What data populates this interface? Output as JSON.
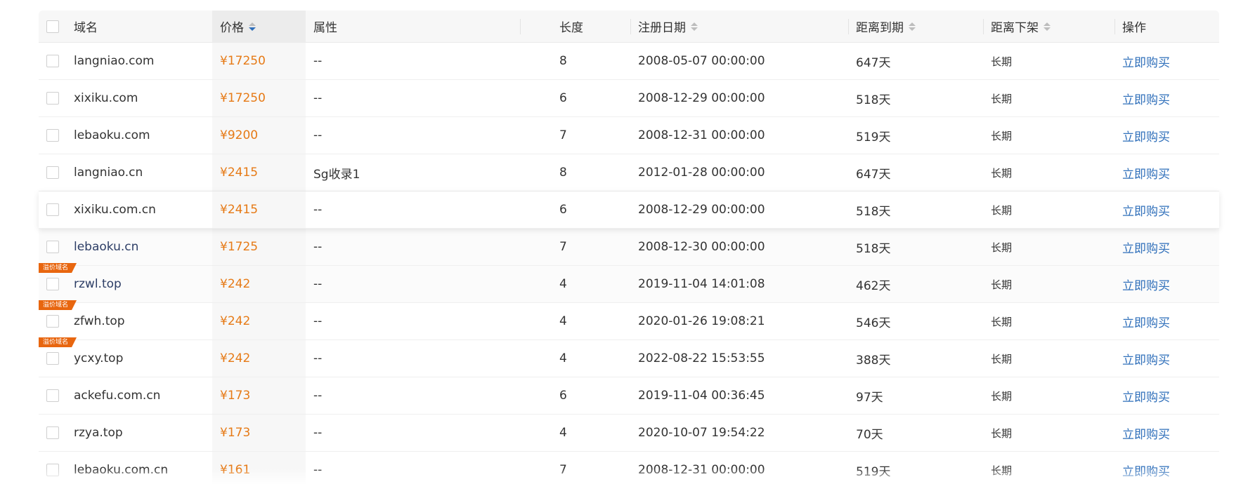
{
  "header": {
    "domain": "域名",
    "price": "价格",
    "attr": "属性",
    "length": "长度",
    "reg_date": "注册日期",
    "expire": "距离到期",
    "offshelf": "距离下架",
    "op": "操作"
  },
  "rows": [
    {
      "domain": "langniao.com",
      "price": "¥17250",
      "attr": "--",
      "length": "8",
      "reg_date": "2008-05-07 00:00:00",
      "expire": "647天",
      "offshelf": "长期",
      "op": "立即购买"
    },
    {
      "domain": "xixiku.com",
      "price": "¥17250",
      "attr": "--",
      "length": "6",
      "reg_date": "2008-12-29 00:00:00",
      "expire": "518天",
      "offshelf": "长期",
      "op": "立即购买"
    },
    {
      "domain": "lebaoku.com",
      "price": "¥9200",
      "attr": "--",
      "length": "7",
      "reg_date": "2008-12-31 00:00:00",
      "expire": "519天",
      "offshelf": "长期",
      "op": "立即购买"
    },
    {
      "domain": "langniao.cn",
      "price": "¥2415",
      "attr": "Sg收录1",
      "length": "8",
      "reg_date": "2012-01-28 00:00:00",
      "expire": "647天",
      "offshelf": "长期",
      "op": "立即购买"
    },
    {
      "domain": "xixiku.com.cn",
      "price": "¥2415",
      "attr": "--",
      "length": "6",
      "reg_date": "2008-12-29 00:00:00",
      "expire": "518天",
      "offshelf": "长期",
      "op": "立即购买"
    },
    {
      "domain": "lebaoku.cn",
      "price": "¥1725",
      "attr": "--",
      "length": "7",
      "reg_date": "2008-12-30 00:00:00",
      "expire": "518天",
      "offshelf": "长期",
      "op": "立即购买"
    },
    {
      "domain": "rzwl.top",
      "price": "¥242",
      "attr": "--",
      "length": "4",
      "reg_date": "2019-11-04 14:01:08",
      "expire": "462天",
      "offshelf": "长期",
      "op": "立即购买",
      "badge": "溢价域名"
    },
    {
      "domain": "zfwh.top",
      "price": "¥242",
      "attr": "--",
      "length": "4",
      "reg_date": "2020-01-26 19:08:21",
      "expire": "546天",
      "offshelf": "长期",
      "op": "立即购买",
      "badge": "溢价域名"
    },
    {
      "domain": "ycxy.top",
      "price": "¥242",
      "attr": "--",
      "length": "4",
      "reg_date": "2022-08-22 15:53:55",
      "expire": "388天",
      "offshelf": "长期",
      "op": "立即购买",
      "badge": "溢价域名"
    },
    {
      "domain": "ackefu.com.cn",
      "price": "¥173",
      "attr": "--",
      "length": "6",
      "reg_date": "2019-11-04 00:36:45",
      "expire": "97天",
      "offshelf": "长期",
      "op": "立即购买"
    },
    {
      "domain": "rzya.top",
      "price": "¥173",
      "attr": "--",
      "length": "4",
      "reg_date": "2020-10-07 19:54:22",
      "expire": "70天",
      "offshelf": "长期",
      "op": "立即购买"
    },
    {
      "domain": "lebaoku.com.cn",
      "price": "¥161",
      "attr": "--",
      "length": "7",
      "reg_date": "2008-12-31 00:00:00",
      "expire": "519天",
      "offshelf": "长期",
      "op": "立即购买"
    }
  ],
  "colors": {
    "price": "#e67a16",
    "link": "#2f6fba",
    "badge": "#e8660f",
    "sort_active": "#2f6fba"
  }
}
